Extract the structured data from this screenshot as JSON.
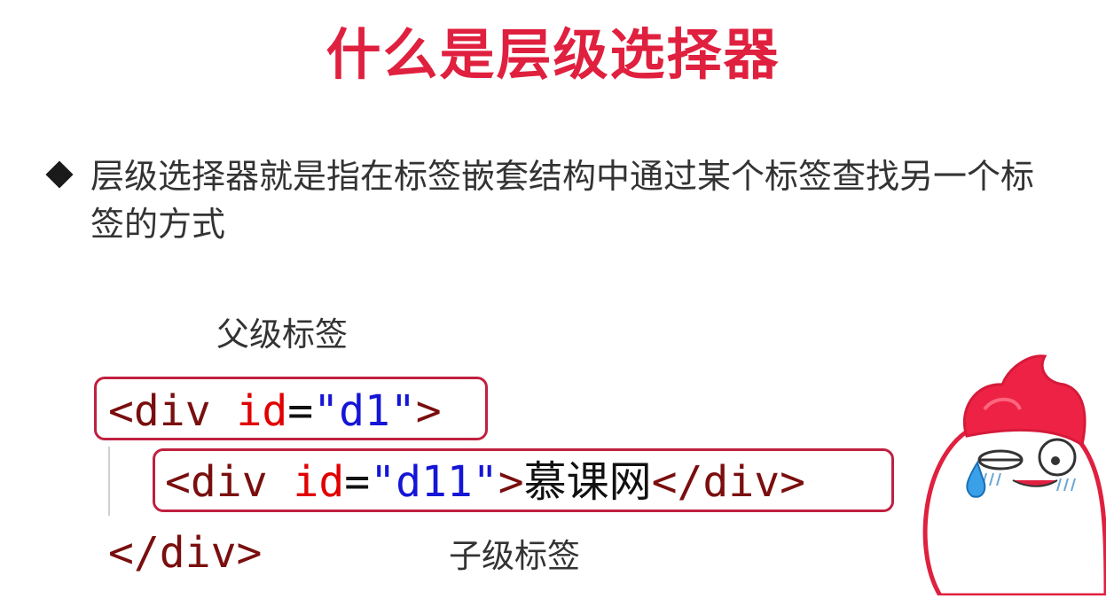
{
  "slide": {
    "title": "什么是层级选择器",
    "bullet_text": "层级选择器就是指在标签嵌套结构中通过某个标签查找另一个标签的方式",
    "parent_label": "父级标签",
    "child_label": "子级标签"
  },
  "code": {
    "line1": {
      "open": "<div ",
      "attr": "id",
      "eq": "=",
      "value": "\"d1\"",
      "close": ">"
    },
    "line2": {
      "open": "<div ",
      "attr": "id",
      "eq": "=",
      "value": "\"d11\"",
      "close": ">",
      "content": "慕课网",
      "end_tag": "</div>"
    },
    "line3": {
      "end_tag": "</div>"
    }
  },
  "colors": {
    "title": "#e0203f",
    "tag": "#7a0e0e",
    "attr": "#e00000",
    "value": "#1515d6",
    "highlight_box": "#c0203f"
  },
  "icons": {
    "bullet": "diamond-bullet-icon",
    "mascot": "mascot-character-icon"
  }
}
